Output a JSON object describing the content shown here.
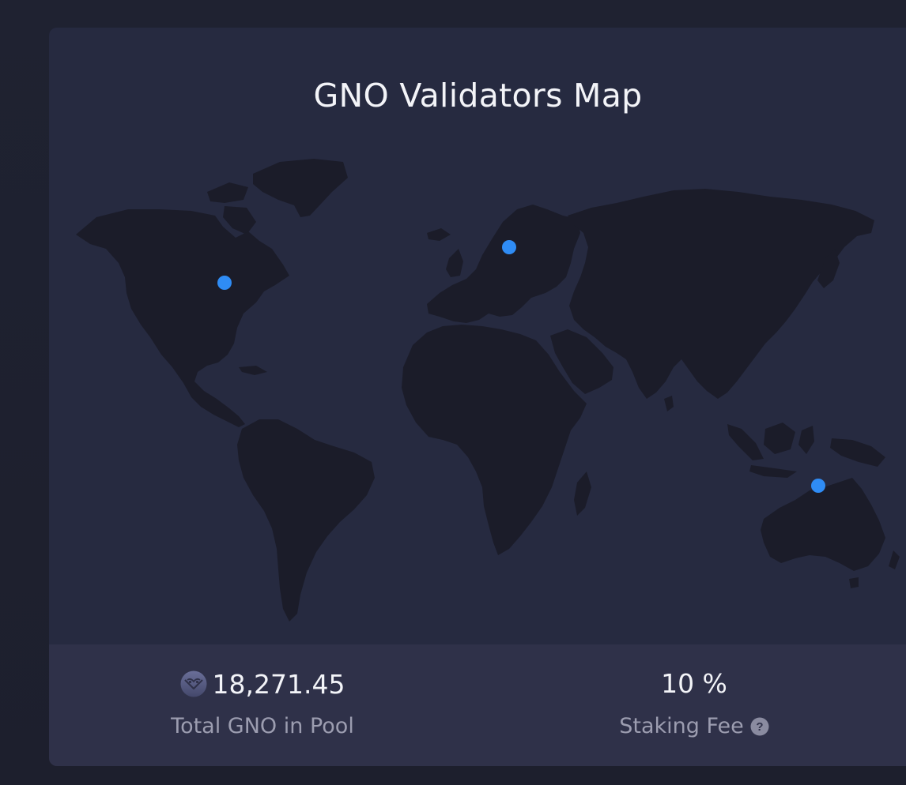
{
  "card": {
    "title": "GNO Validators Map"
  },
  "map": {
    "land_color": "#1b1c29",
    "marker_color": "#2f8cf5",
    "markers": [
      "north-america-validator",
      "europe-validator",
      "australia-validator"
    ]
  },
  "stats": {
    "total_gno": {
      "icon": "gno-token-icon",
      "value": "18,271.45",
      "label": "Total GNO in Pool"
    },
    "staking_fee": {
      "value": "10 %",
      "label": "Staking Fee",
      "help_icon": "question-circle-icon"
    }
  },
  "colors": {
    "page_background": "#1e2030",
    "card_background": "#262a40",
    "stats_background": "#2f3149",
    "title_text": "#f3f4f8",
    "label_text": "#9c9db0"
  }
}
